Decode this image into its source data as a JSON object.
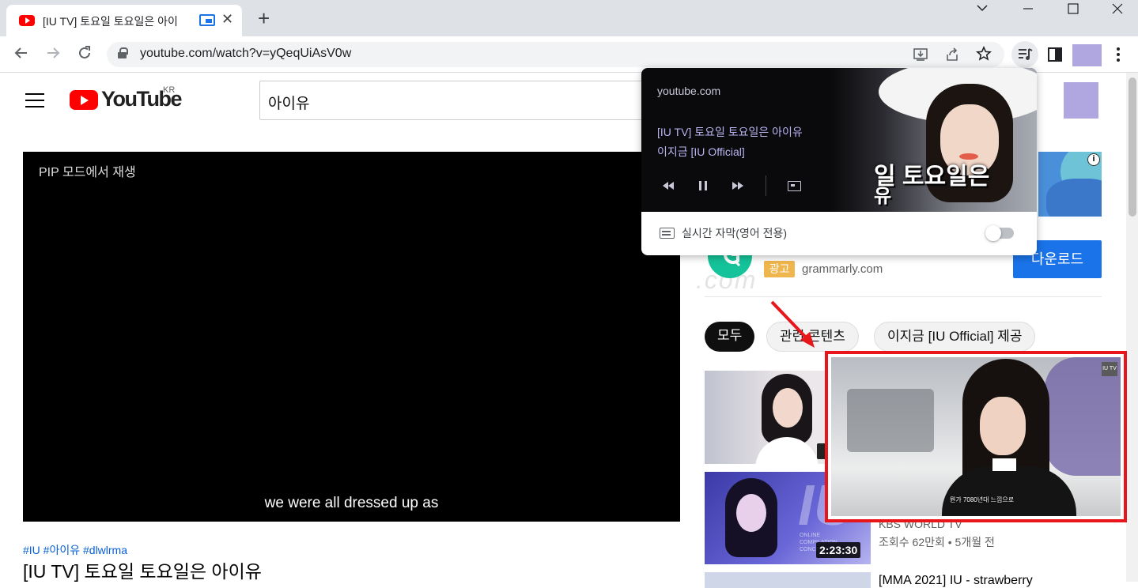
{
  "browser": {
    "tab_title": "[IU TV] 토요일 토요일은 아이",
    "url": "youtube.com/watch?v=yQeqUiAsV0w",
    "new_tab_glyph": "+",
    "close_glyph": "✕"
  },
  "youtube": {
    "logo_text": "YouTube",
    "logo_region": "KR",
    "search_query": "아이유"
  },
  "video": {
    "pip_notice": "PIP 모드에서 재생",
    "caption": "we were all dressed up as",
    "hashtags": "#IU #아이유 #dlwlrma",
    "title": "[IU TV] 토요일 토요일은 아이유"
  },
  "ad": {
    "badge": "광고",
    "domain": "grammarly.com",
    "download_label": "다운로드",
    "info_glyph": "i"
  },
  "chips": {
    "all": "모두",
    "related": "관련 콘텐츠",
    "channel": "이지금 [IU Official] 제공"
  },
  "related": {
    "item2": {
      "channel": "KBS WORLD TV",
      "meta": "조회수 62만회 • 5개월 전",
      "duration": "2:23:30"
    },
    "item3": {
      "title": "[MMA 2021] IU - strawberry"
    }
  },
  "media_popup": {
    "domain": "youtube.com",
    "title": "[IU TV] 토요일 토요일은 아이유",
    "artist": "이지금 [IU Official]",
    "art_text_1": "일 토요일은",
    "art_text_2": "유",
    "live_caption_label": "실시간 자막(영어 전용)",
    "live_caption_enabled": false
  },
  "pip_window": {
    "subtitle": "뭔가 7080년대 느낌으로",
    "corner_badge": "IU TV"
  },
  "colors": {
    "highlight_border": "#e8161b",
    "annotation_arrow": "#e8161b",
    "accent_blue": "#1a73e8",
    "youtube_red": "#ff0000"
  }
}
